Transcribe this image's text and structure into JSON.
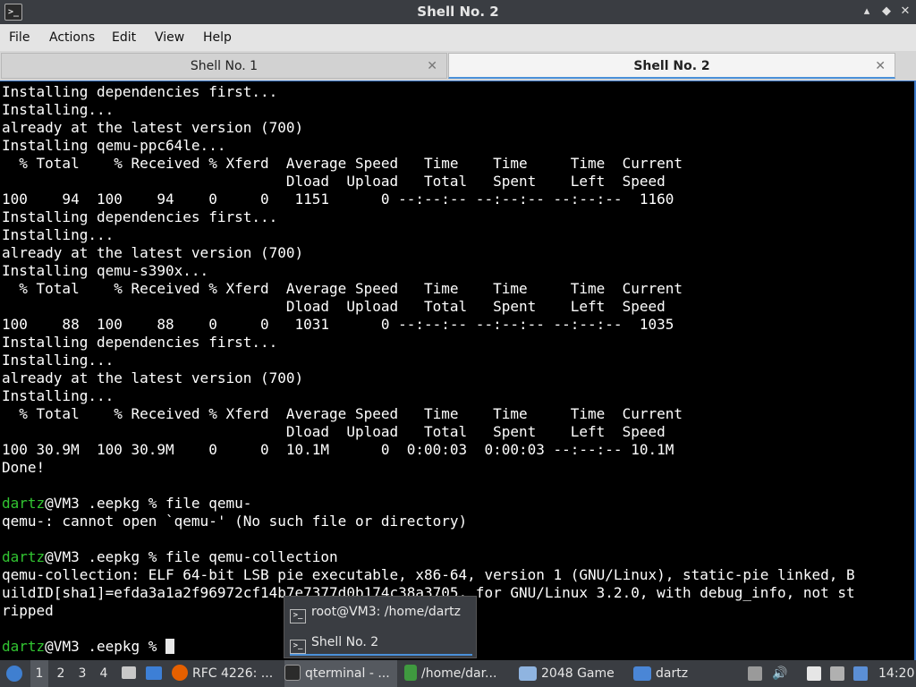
{
  "window": {
    "title": "Shell No. 2",
    "controls": {
      "minimize": "▴",
      "maximize": "◆",
      "close": "✕"
    }
  },
  "menubar": {
    "items": [
      "File",
      "Actions",
      "Edit",
      "View",
      "Help"
    ]
  },
  "tabs": [
    {
      "label": "Shell No. 1",
      "active": false
    },
    {
      "label": "Shell No. 2",
      "active": true
    }
  ],
  "terminal": {
    "lines": [
      {
        "text": "Installing dependencies first..."
      },
      {
        "text": "Installing..."
      },
      {
        "text": "already at the latest version (700)"
      },
      {
        "text": "Installing qemu-ppc64le..."
      },
      {
        "text": "  % Total    % Received % Xferd  Average Speed   Time    Time     Time  Current"
      },
      {
        "text": "                                 Dload  Upload   Total   Spent    Left  Speed"
      },
      {
        "text": "100    94  100    94    0     0   1151      0 --:--:-- --:--:-- --:--:--  1160"
      },
      {
        "text": "Installing dependencies first..."
      },
      {
        "text": "Installing..."
      },
      {
        "text": "already at the latest version (700)"
      },
      {
        "text": "Installing qemu-s390x..."
      },
      {
        "text": "  % Total    % Received % Xferd  Average Speed   Time    Time     Time  Current"
      },
      {
        "text": "                                 Dload  Upload   Total   Spent    Left  Speed"
      },
      {
        "text": "100    88  100    88    0     0   1031      0 --:--:-- --:--:-- --:--:--  1035"
      },
      {
        "text": "Installing dependencies first..."
      },
      {
        "text": "Installing..."
      },
      {
        "text": "already at the latest version (700)"
      },
      {
        "text": "Installing..."
      },
      {
        "text": "  % Total    % Received % Xferd  Average Speed   Time    Time     Time  Current"
      },
      {
        "text": "                                 Dload  Upload   Total   Spent    Left  Speed"
      },
      {
        "text": "100 30.9M  100 30.9M    0     0  10.1M      0  0:00:03  0:00:03 --:--:-- 10.1M"
      },
      {
        "text": "Done!"
      },
      {
        "text": ""
      },
      {
        "user": "dartz",
        "text": "@VM3 .eepkg % file qemu-"
      },
      {
        "text": "qemu-: cannot open `qemu-' (No such file or directory)"
      },
      {
        "text": ""
      },
      {
        "user": "dartz",
        "text": "@VM3 .eepkg % file qemu-collection"
      },
      {
        "text": "qemu-collection: ELF 64-bit LSB pie executable, x86-64, version 1 (GNU/Linux), static-pie linked, B"
      },
      {
        "text": "uildID[sha1]=efda3a1a2f96972cf14b7e7377d0b174c38a3705, for GNU/Linux 3.2.0, with debug_info, not st"
      },
      {
        "text": "ripped"
      },
      {
        "text": ""
      },
      {
        "user": "dartz",
        "text": "@VM3 .eepkg % ",
        "cursor": true
      }
    ]
  },
  "popup": {
    "items": [
      {
        "label": "root@VM3: /home/dartz",
        "selected": false
      },
      {
        "label": "Shell No. 2",
        "selected": true
      }
    ]
  },
  "taskbar": {
    "desktops": [
      "1",
      "2",
      "3",
      "4"
    ],
    "active_desktop": "1",
    "tasks": [
      {
        "label": "RFC 4226: ...",
        "icon": "firefox-icon",
        "color": "#e66000",
        "active": false
      },
      {
        "label": "qterminal - ...",
        "icon": "terminal-icon",
        "color": "#2b2b2b",
        "active": true
      },
      {
        "label": "/home/dar...",
        "icon": "text-editor-icon",
        "color": "#3f9a3f",
        "active": false
      },
      {
        "label": "2048 Game",
        "icon": "window-icon",
        "color": "#8fb4e0",
        "active": false
      },
      {
        "label": "dartz",
        "icon": "folder-icon",
        "color": "#4a86d6",
        "active": false
      }
    ],
    "clock": "14:20",
    "colors": {
      "accent": "#4a90d9",
      "prompt_user": "#31c431"
    }
  }
}
